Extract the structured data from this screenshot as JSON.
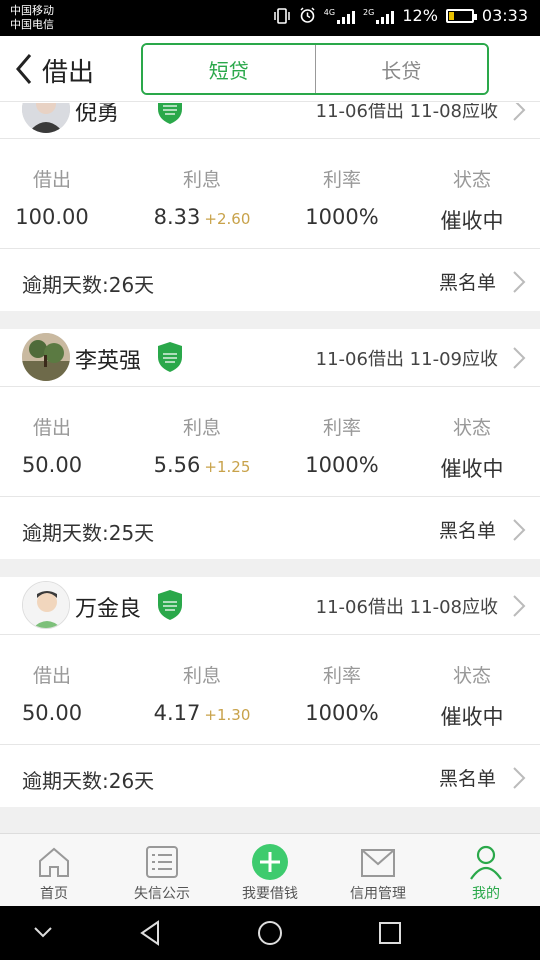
{
  "status_bar": {
    "carrier1": "中国移动",
    "carrier2": "中国电信",
    "network1": "4G",
    "network2": "2G",
    "battery": "12%",
    "time": "03:33"
  },
  "header": {
    "title": "借出",
    "tabs": [
      "短贷",
      "长贷"
    ],
    "active_tab": "短贷"
  },
  "columns": {
    "loan": "借出",
    "interest": "利息",
    "rate": "利率",
    "status": "状态"
  },
  "records": [
    {
      "name": "倪勇",
      "dates": "11-06借出 11-08应收",
      "amount": "100.00",
      "interest": "8.33",
      "interest_extra": "+2.60",
      "rate": "1000%",
      "status": "催收中",
      "overdue": "逾期天数:26天",
      "blacklist": "黑名单"
    },
    {
      "name": "李英强",
      "dates": "11-06借出 11-09应收",
      "amount": "50.00",
      "interest": "5.56",
      "interest_extra": "+1.25",
      "rate": "1000%",
      "status": "催收中",
      "overdue": "逾期天数:25天",
      "blacklist": "黑名单"
    },
    {
      "name": "万金良",
      "dates": "11-06借出 11-08应收",
      "amount": "50.00",
      "interest": "4.17",
      "interest_extra": "+1.30",
      "rate": "1000%",
      "status": "催收中",
      "overdue": "逾期天数:26天",
      "blacklist": "黑名单"
    }
  ],
  "tabbar": {
    "items": [
      "首页",
      "失信公示",
      "我要借钱",
      "信用管理",
      "我的"
    ],
    "active": "我的"
  },
  "colors": {
    "accent": "#2aa84a",
    "interest_extra": "#c8a24a"
  }
}
